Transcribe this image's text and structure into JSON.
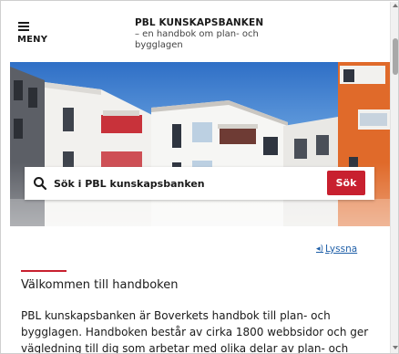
{
  "header": {
    "menu_label": "MENY",
    "brand_title": "PBL KUNSKAPSBANKEN",
    "brand_subtitle_line1": "– en handbok om plan- och",
    "brand_subtitle_line2": "bygglagen"
  },
  "search": {
    "placeholder": "Sök i PBL kunskapsbanken",
    "button_label": "Sök"
  },
  "listen": {
    "icon": "speaker-icon",
    "label": "Lyssna"
  },
  "content": {
    "heading": "Välkommen till handboken",
    "intro_line1": "PBL kunskapsbanken är Boverkets handbok till plan- och",
    "intro_line2": "bygglagen. Handboken består av cirka 1800 webbsidor och ger",
    "intro_line3": "vägledning till dig som arbetar med olika delar av plan- och"
  },
  "colors": {
    "accent_red": "#c8202f",
    "link_blue": "#1f5fa8",
    "sky_blue": "#3d7dd0"
  }
}
